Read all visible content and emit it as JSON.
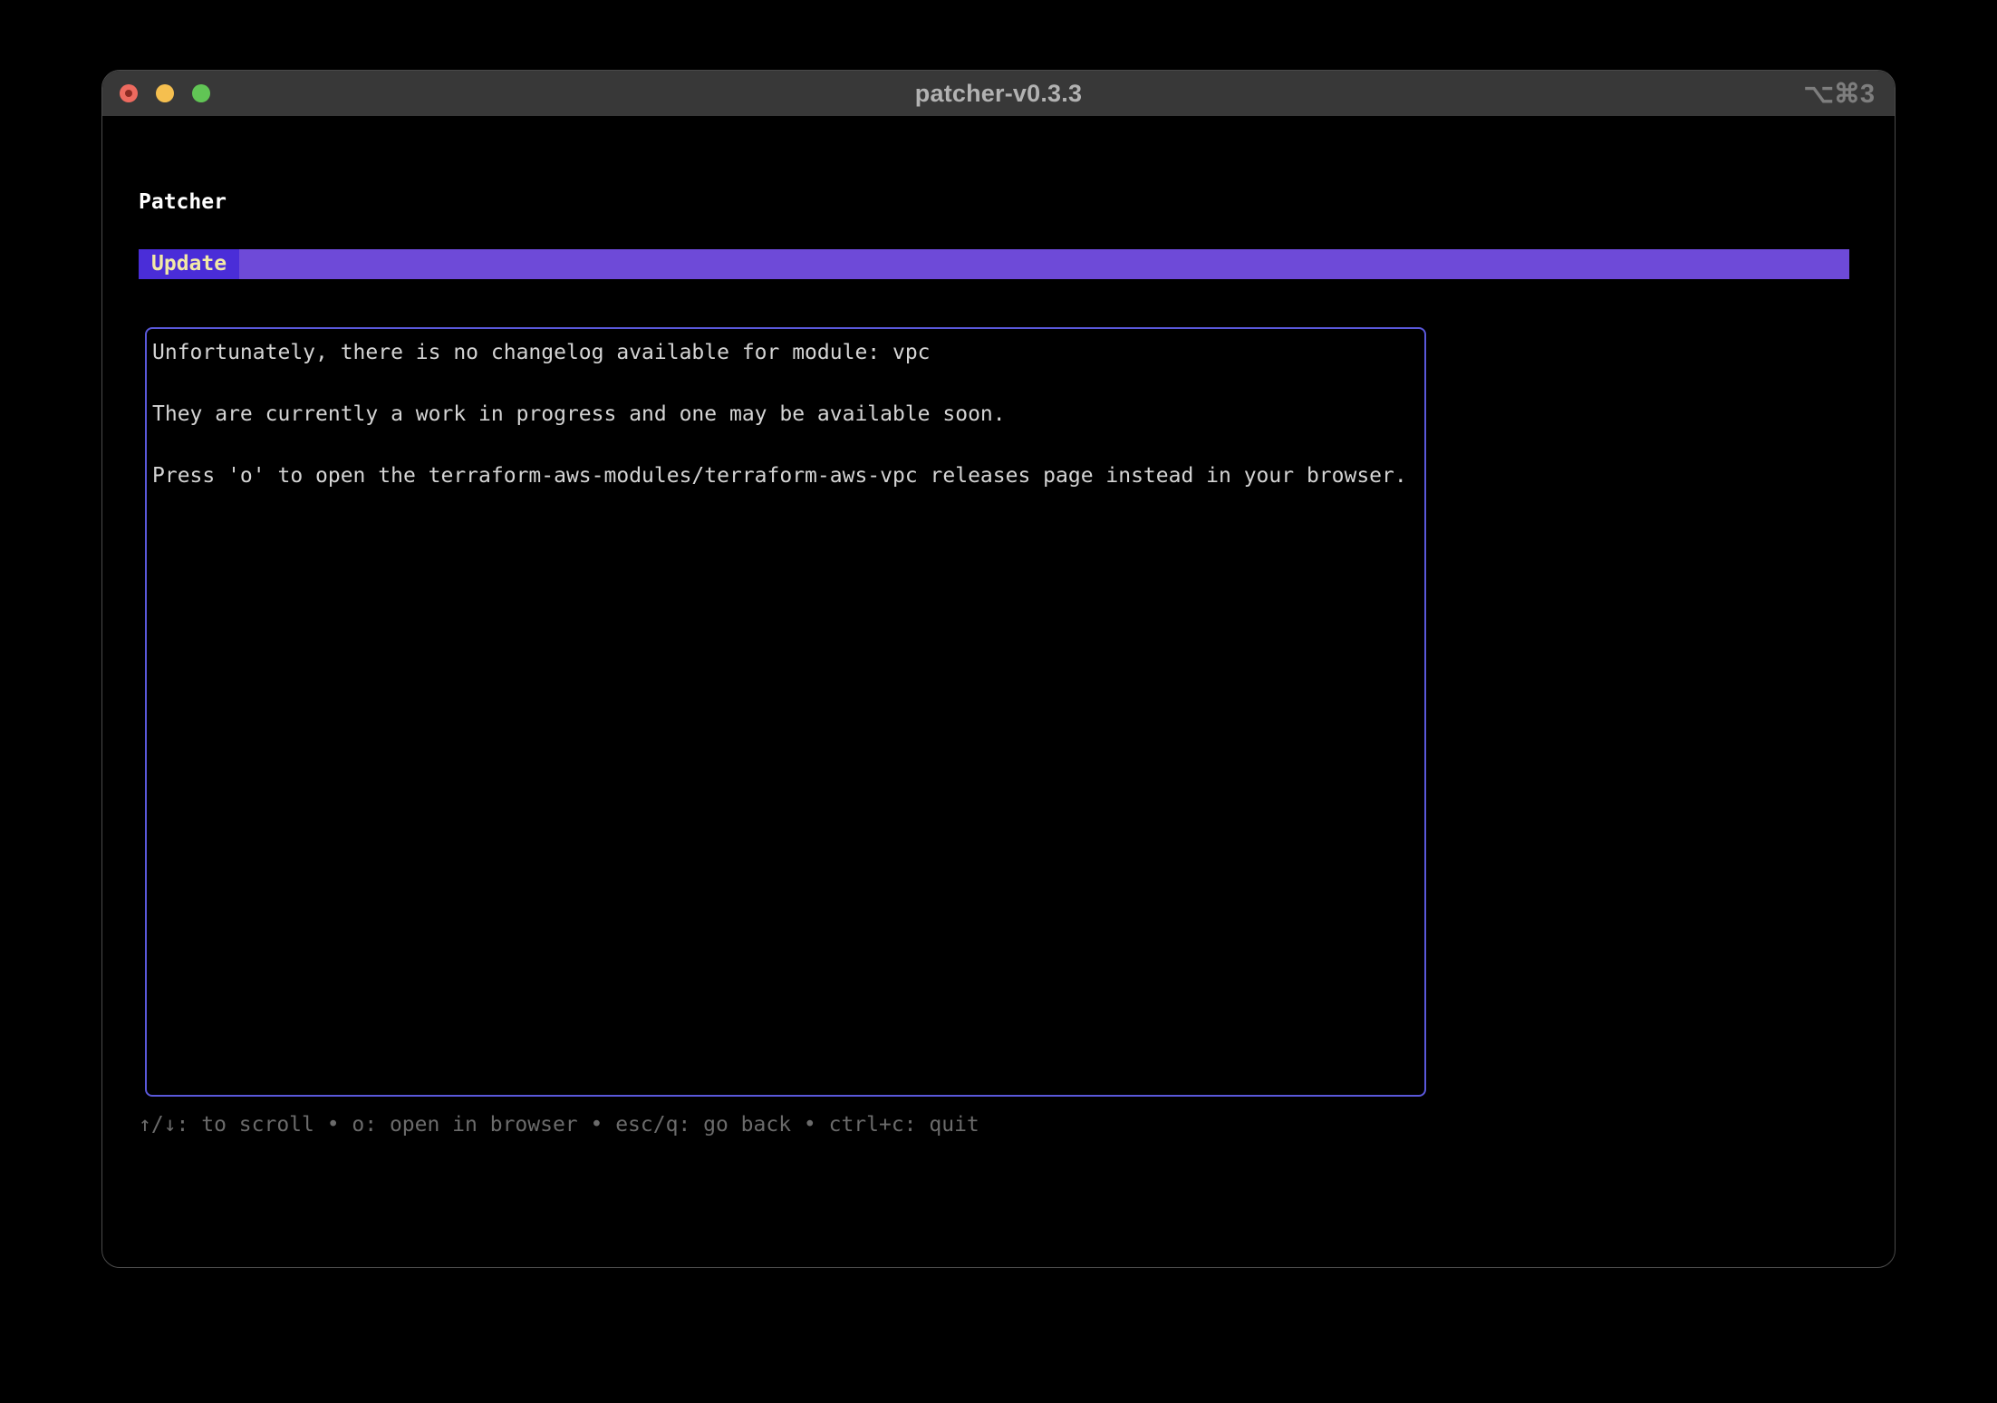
{
  "window": {
    "title": "patcher-v0.3.3",
    "shortcut_hint": "⌥⌘3"
  },
  "app": {
    "heading": "Patcher",
    "tabs": [
      {
        "label": "Update",
        "active": true
      }
    ]
  },
  "changelog": {
    "lines": [
      "Unfortunately, there is no changelog available for module: vpc",
      "They are currently a work in progress and one may be available soon.",
      "Press 'o' to open the terraform-aws-modules/terraform-aws-vpc releases page instead in your browser."
    ]
  },
  "help": {
    "text": "↑/↓: to scroll • o: open in browser • esc/q: go back • ctrl+c: quit"
  },
  "colors": {
    "tab_active_bg": "#4a2dd8",
    "tab_bar_bg": "#6e4ad8",
    "tab_text": "#f2e9a6",
    "box_border": "#5a58da",
    "terminal_text": "#d4d4d4",
    "help_text": "#6b6b6b",
    "titlebar_bg": "#383838",
    "title_text": "#b2b2b2",
    "shortcut_text": "#7e7e7e",
    "close_btn": "#ed6a5f",
    "close_dot": "#8c2b23",
    "min_btn": "#f5bf4f",
    "zoom_btn": "#61c555"
  }
}
